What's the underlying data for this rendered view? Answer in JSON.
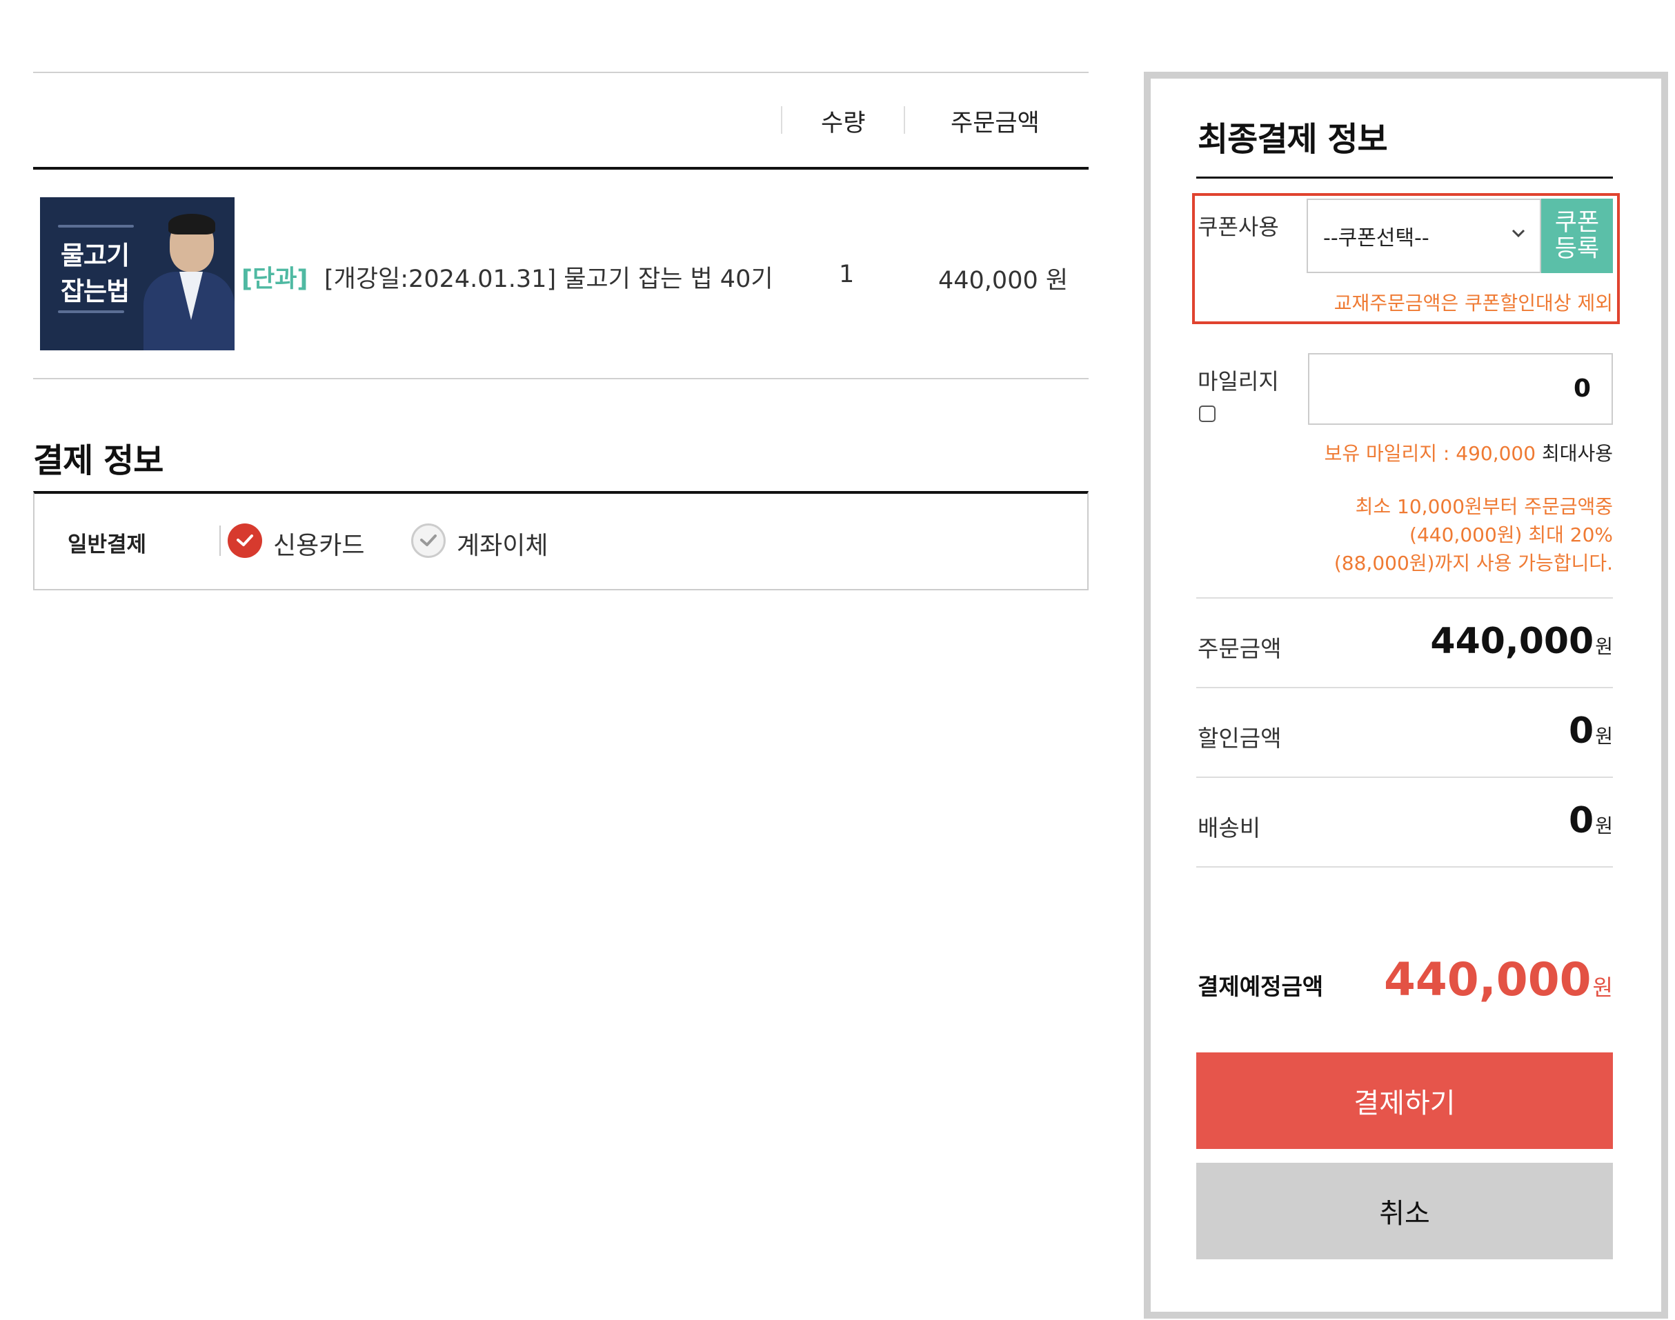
{
  "order_table": {
    "headers": {
      "quantity": "수량",
      "amount": "주문금액"
    },
    "thumbnail": {
      "title_line1": "물고기",
      "title_line2": "잡는법"
    },
    "item": {
      "tag": "[단과]",
      "name": "[개강일:2024.01.31] 물고기 잡는 법 40기",
      "quantity": "1",
      "amount": "440,000 원"
    }
  },
  "payment_info": {
    "title": "결제 정보",
    "row_label": "일반결제",
    "methods": [
      {
        "label": "신용카드",
        "selected": true
      },
      {
        "label": "계좌이체",
        "selected": false
      }
    ]
  },
  "final_panel": {
    "title": "최종결제 정보",
    "coupon": {
      "label": "쿠폰사용",
      "select_value": "--쿠폰선택--",
      "register_line1": "쿠폰",
      "register_line2": "등록",
      "note": "교재주문금액은 쿠폰할인대상 제외"
    },
    "mileage": {
      "label": "마일리지",
      "input_value": "0",
      "held_prefix": "보유 마일리지 : 490,000",
      "held_suffix": "최대사용",
      "rule_line1": "최소 10,000원부터 주문금액중",
      "rule_line2": "(440,000원) 최대 20%",
      "rule_line3": "(88,000원)까지 사용 가능합니다."
    },
    "summary": {
      "order_amount_label": "주문금액",
      "order_amount_value": "440,000",
      "discount_label": "할인금액",
      "discount_value": "0",
      "shipping_label": "배송비",
      "shipping_value": "0",
      "currency": "원"
    },
    "total": {
      "label": "결제예정금액",
      "value": "440,000",
      "currency": "원"
    },
    "pay_button": "결제하기",
    "cancel_button": "취소"
  },
  "colors": {
    "accent_red": "#e6554b",
    "highlight_border": "#e0432f",
    "tag_teal": "#4fb9a2",
    "note_orange": "#ef7a33",
    "register_green": "#5bbfa8"
  }
}
